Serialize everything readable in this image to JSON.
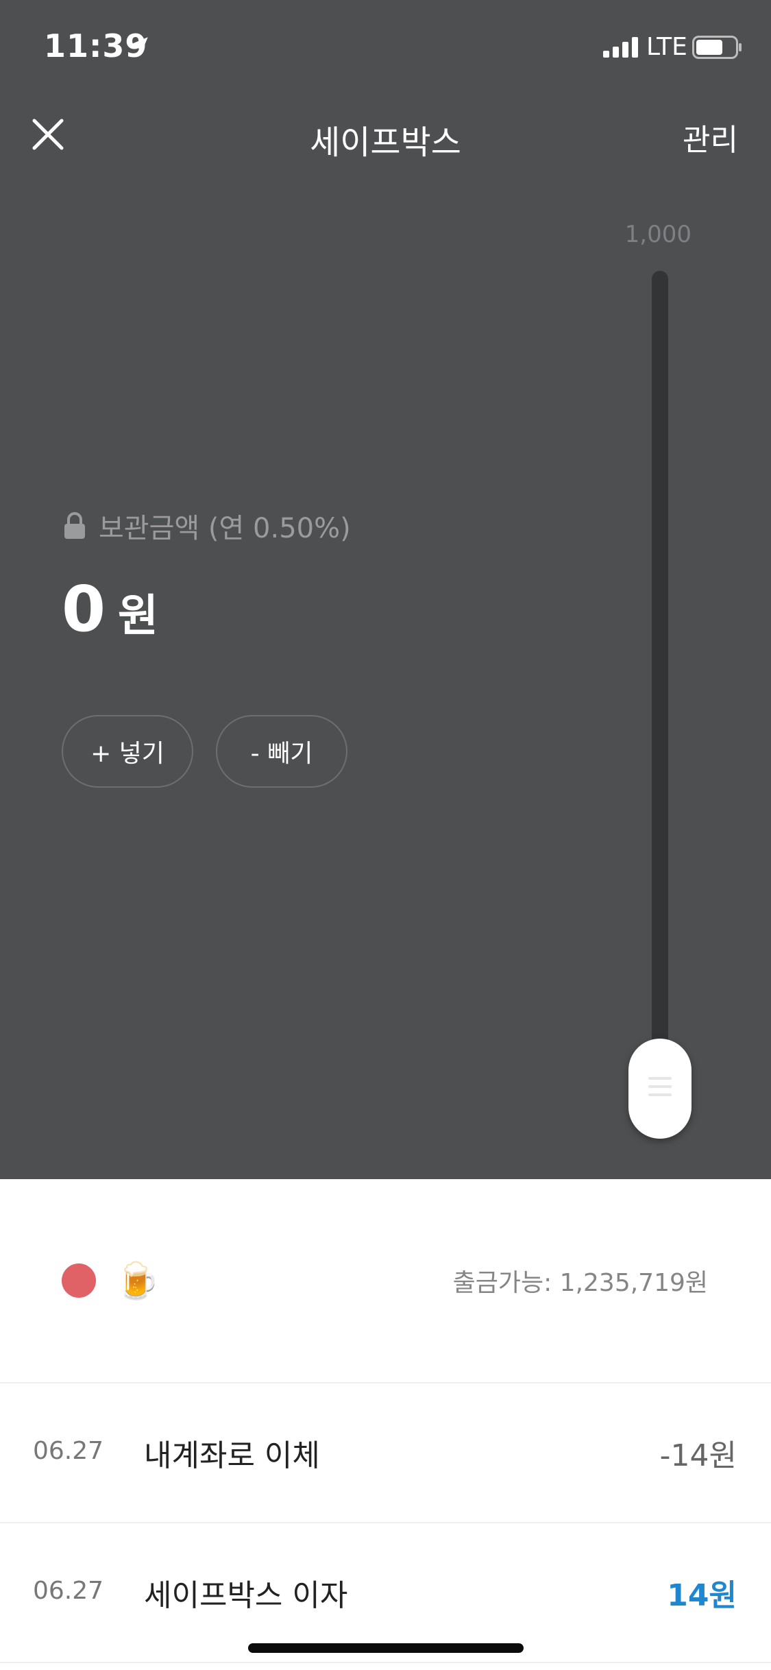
{
  "status_bar": {
    "time": "11:39",
    "network": "LTE",
    "icons": [
      "location-arrow-icon",
      "signal-bars-icon",
      "battery-icon"
    ]
  },
  "nav": {
    "title": "세이프박스",
    "manage_label": "관리",
    "close_icon": "close-icon"
  },
  "slider": {
    "max_label": "1,000",
    "value": 0
  },
  "balance": {
    "label": "보관금액 (연 0.50%)",
    "amount": "0",
    "unit": "원"
  },
  "actions": {
    "deposit_label": "+ 넣기",
    "withdraw_label": "- 빼기"
  },
  "account": {
    "emoji": "🍺",
    "dot_color": "#e06166",
    "available_text": "출금가능: 1,235,719원"
  },
  "transactions": [
    {
      "date": "06.27",
      "title": "내계좌로 이체",
      "amount": "-14원",
      "color": "#666666"
    },
    {
      "date": "06.27",
      "title": "세이프박스 이자",
      "amount": "14원",
      "color": "#1f86d0"
    }
  ],
  "colors": {
    "header_bg": "#4e4f51",
    "positive": "#1f86d0"
  }
}
